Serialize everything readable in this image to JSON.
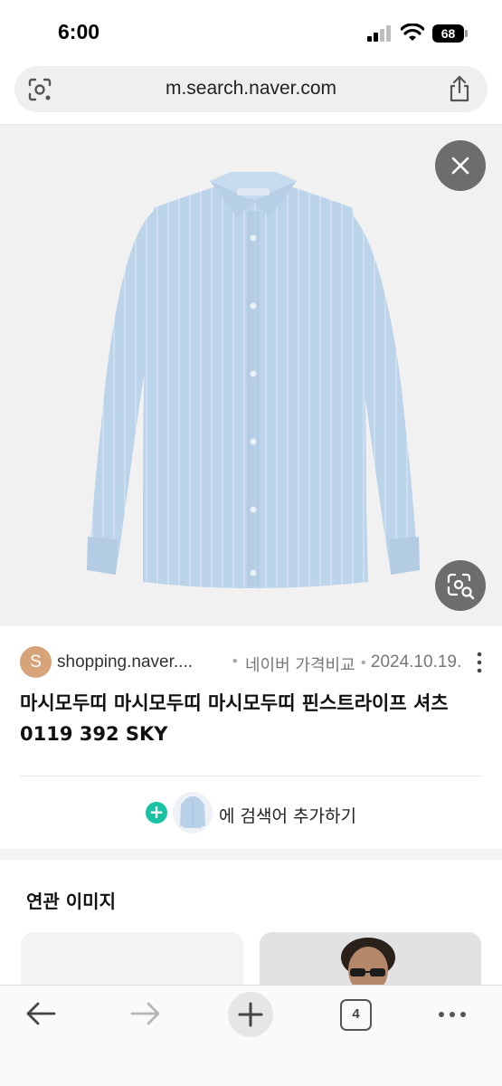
{
  "status_bar": {
    "time": "6:00",
    "battery": "68"
  },
  "url_bar": {
    "url": "m.search.naver.com",
    "icons": [
      "lens-icon",
      "share-icon"
    ]
  },
  "viewer": {
    "image": "light blue pinstripe dress shirt",
    "buttons": [
      "close-icon",
      "lens-search-icon"
    ]
  },
  "result": {
    "source_initial": "S",
    "source_site": "shopping.naver....",
    "separator": "•",
    "source_name": "네이버 가격비교",
    "date": "2024.10.19.",
    "title": "마시모두띠 마시모두띠 마시모두띠 핀스트라이프 셔츠 0119 392 SKY"
  },
  "add_keyword": {
    "label": "에 검색어 추가하기"
  },
  "related": {
    "title": "연관 이미지"
  },
  "toolbar": {
    "tab_count": "4"
  },
  "colors": {
    "accent_green": "#19c2a2",
    "shirt_blue": "#bcd4ea",
    "overlay_button": "#6d6d6d"
  }
}
